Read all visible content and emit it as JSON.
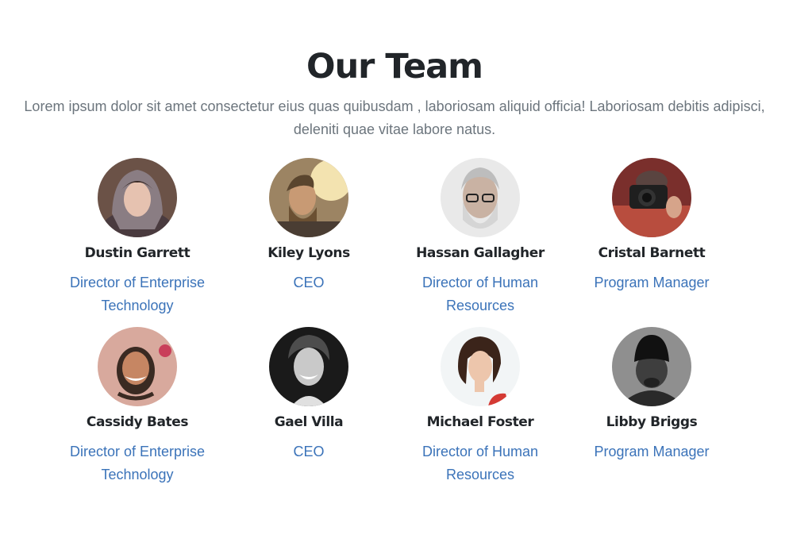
{
  "header": {
    "title": "Our Team",
    "subtitle": "Lorem ipsum dolor sit amet consectetur eius quas quibusdam , laboriosam aliquid officia! Laboriosam debitis adipisci, deleniti quae vitae labore natus."
  },
  "team": [
    {
      "name": "Dustin Garrett",
      "role": "Director of Enterprise Technology"
    },
    {
      "name": "Kiley Lyons",
      "role": "CEO"
    },
    {
      "name": "Hassan Gallagher",
      "role": "Director of Human Resources"
    },
    {
      "name": "Cristal Barnett",
      "role": "Program Manager"
    },
    {
      "name": "Cassidy Bates",
      "role": "Director of Enterprise Technology"
    },
    {
      "name": "Gael Villa",
      "role": "CEO"
    },
    {
      "name": "Michael Foster",
      "role": "Director of Human Resources"
    },
    {
      "name": "Libby Briggs",
      "role": "Program Manager"
    }
  ],
  "colors": {
    "heading": "#212529",
    "muted": "#6c757d",
    "link": "#3b73b9"
  }
}
